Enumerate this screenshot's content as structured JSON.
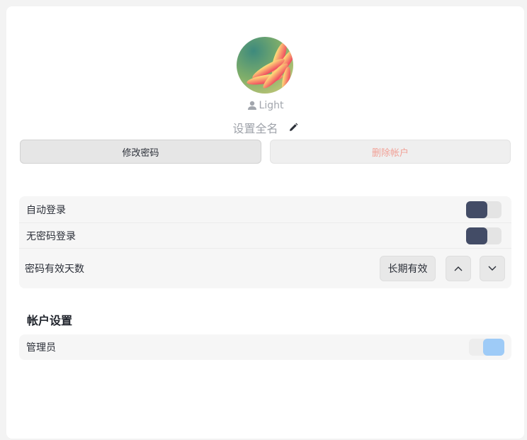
{
  "profile": {
    "username": "Light",
    "fullname_placeholder": "设置全名"
  },
  "actions": {
    "change_password": "修改密码",
    "delete_account": "删除帐户"
  },
  "login_settings": {
    "auto_login": {
      "label": "自动登录",
      "enabled": true
    },
    "passwordless_login": {
      "label": "无密码登录",
      "enabled": true
    },
    "password_validity": {
      "label": "密码有效天数",
      "value": "长期有效"
    }
  },
  "account_settings": {
    "title": "帐户设置",
    "admin": {
      "label": "管理员",
      "enabled": true
    }
  },
  "colors": {
    "toggle_dark": "#434c66",
    "toggle_accent": "#9ecbf7",
    "delete_text": "#f1a197"
  },
  "icons": {
    "user": "user-icon",
    "edit": "pencil-icon",
    "up": "chevron-up-icon",
    "down": "chevron-down-icon"
  }
}
